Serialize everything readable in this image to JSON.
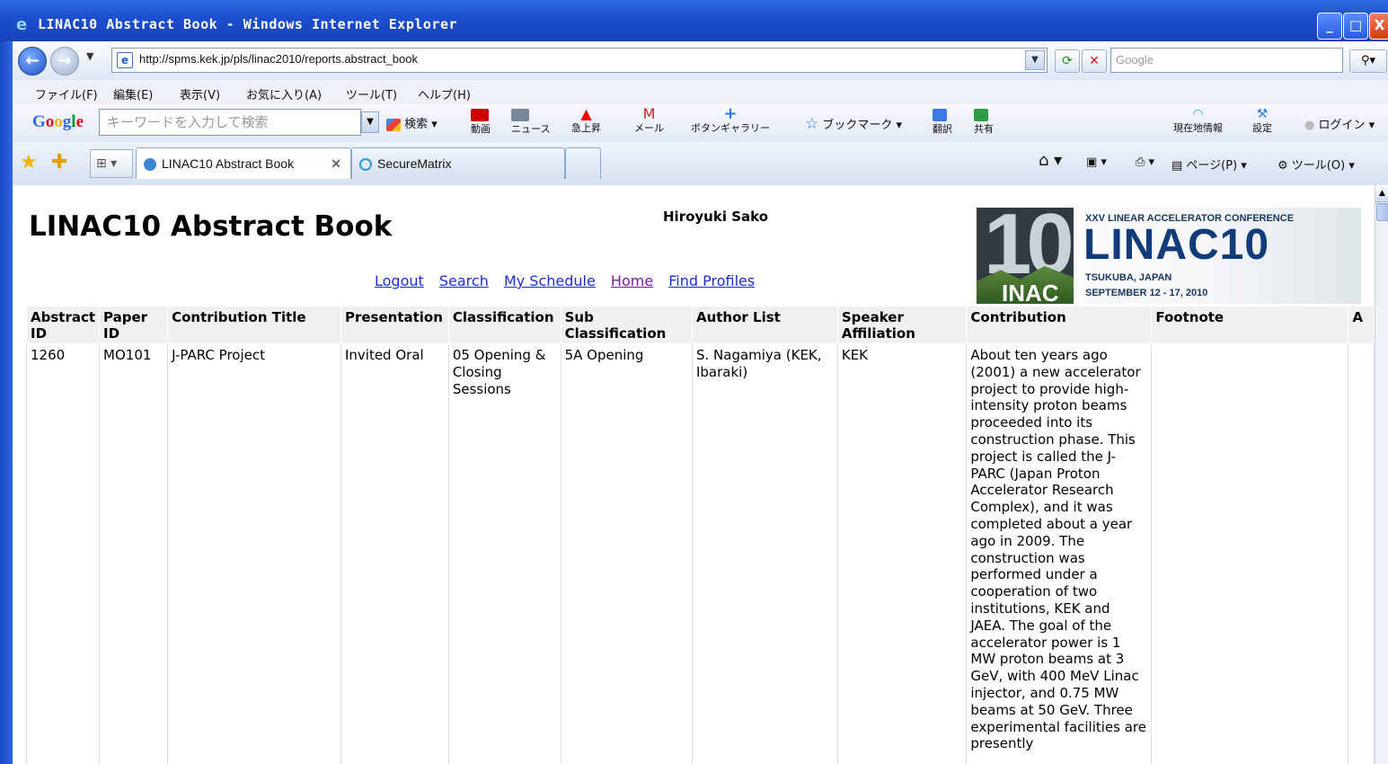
{
  "window": {
    "title": "LINAC10 Abstract Book - Windows Internet Explorer",
    "buttons": {
      "min": "_",
      "max": "□",
      "close": "X"
    }
  },
  "nav": {
    "url": "http://spms.kek.jp/pls/linac2010/reports.abstract_book",
    "search_placeholder": "Google"
  },
  "menu": [
    "ファイル(F)",
    "編集(E)",
    "表示(V)",
    "お気に入り(A)",
    "ツール(T)",
    "ヘルプ(H)"
  ],
  "google_toolbar": {
    "placeholder": "キーワードを入力して検索",
    "search_label": "検索",
    "items": [
      {
        "label": "動画",
        "icon": "youtube-icon"
      },
      {
        "label": "ニュース",
        "icon": "news-icon"
      },
      {
        "label": "急上昇",
        "icon": "trend-up-icon"
      },
      {
        "label": "メール",
        "icon": "gmail-icon"
      },
      {
        "label": "ボタンギャラリー",
        "icon": "plus-icon"
      },
      {
        "label": "ブックマーク",
        "icon": "star-icon"
      },
      {
        "label": "翻訳",
        "icon": "translate-icon"
      },
      {
        "label": "共有",
        "icon": "share-icon"
      },
      {
        "label": "現在地情報",
        "icon": "wifi-icon"
      },
      {
        "label": "設定",
        "icon": "wrench-icon"
      },
      {
        "label": "ログイン",
        "icon": "login-icon"
      }
    ]
  },
  "tabs": [
    {
      "label": "LINAC10 Abstract Book",
      "active": true
    },
    {
      "label": "SecureMatrix",
      "active": false
    }
  ],
  "command_bar": {
    "page": "ページ(P)",
    "tools": "ツール(O)"
  },
  "page": {
    "title": "LINAC10 Abstract Book",
    "user": "Hiroyuki Sako",
    "links": [
      "Logout",
      "Search",
      "My Schedule",
      "Home",
      "Find Profiles"
    ],
    "logo": {
      "line1": "XXV LINEAR ACCELERATOR CONFERENCE",
      "line2": "LINAC10",
      "line3": "TSUKUBA, JAPAN",
      "line4": "SEPTEMBER 12 - 17, 2010",
      "digits": "10",
      "inac": "INAC"
    },
    "table": {
      "headers": [
        "Abstract ID",
        "Paper ID",
        "Contribution Title",
        "Presentation",
        "Classification",
        "Sub Classification",
        "Author List",
        "Speaker Affiliation",
        "Contribution",
        "Footnote",
        "A"
      ],
      "rows": [
        {
          "abstract_id": "1260",
          "paper_id": "MO101",
          "title": "J-PARC Project",
          "presentation": "Invited Oral",
          "classification": "05 Opening & Closing Sessions",
          "sub_classification": "5A Opening",
          "authors": "S. Nagamiya (KEK, Ibaraki)",
          "affiliation": "KEK",
          "contribution": "About ten years ago (2001) a new accelerator project to provide high-intensity proton beams proceeded into its construction phase. This project is called the J-PARC (Japan Proton Accelerator Research Complex), and it was completed about a year ago in 2009. The construction was performed under a cooperation of two institutions, KEK and JAEA. The goal of the accelerator power is 1 MW proton beams at 3 GeV, with 400 MeV Linac injector, and 0.75 MW beams at 50 GeV. Three experimental facilities are presently",
          "footnote": ""
        }
      ]
    }
  }
}
